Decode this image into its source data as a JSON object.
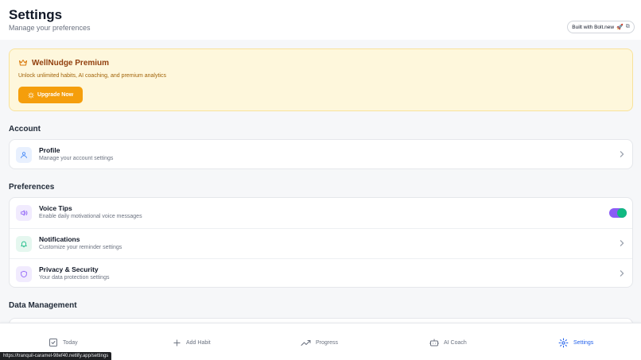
{
  "header": {
    "title": "Settings",
    "subtitle": "Manage your preferences",
    "badge": {
      "label": "Built with Bolt.new",
      "rocket": "🚀",
      "ext": "⧉"
    }
  },
  "premium": {
    "title": "WellNudge Premium",
    "description": "Unlock unlimited habits, AI coaching, and premium analytics",
    "button_label": "Upgrade Now",
    "icon": "crown-icon"
  },
  "sections": {
    "account": {
      "title": "Account",
      "items": [
        {
          "title": "Profile",
          "description": "Manage your account settings",
          "icon": "user-icon"
        }
      ]
    },
    "preferences": {
      "title": "Preferences",
      "items": [
        {
          "title": "Voice Tips",
          "description": "Enable daily motivational voice messages",
          "icon": "speaker-icon",
          "toggle_on": true
        },
        {
          "title": "Notifications",
          "description": "Customize your reminder settings",
          "icon": "bell-icon"
        },
        {
          "title": "Privacy & Security",
          "description": "Your data protection settings",
          "icon": "shield-icon"
        }
      ]
    },
    "data_management": {
      "title": "Data Management"
    }
  },
  "nav": [
    {
      "label": "Today",
      "icon": "calendar-check-icon"
    },
    {
      "label": "Add Habit",
      "icon": "plus-icon"
    },
    {
      "label": "Progress",
      "icon": "trending-up-icon"
    },
    {
      "label": "AI Coach",
      "icon": "bot-icon"
    },
    {
      "label": "Settings",
      "icon": "gear-icon",
      "active": true
    }
  ],
  "status_url": "https://tranquil-caramel-98ef40.netlify.app/settings",
  "colors": {
    "accent": "#2563eb",
    "premium_bg": "#fef7dc",
    "upgrade_button": "#f59e0b",
    "toggle_track": "#8b5cf6",
    "toggle_knob": "#10b981"
  }
}
